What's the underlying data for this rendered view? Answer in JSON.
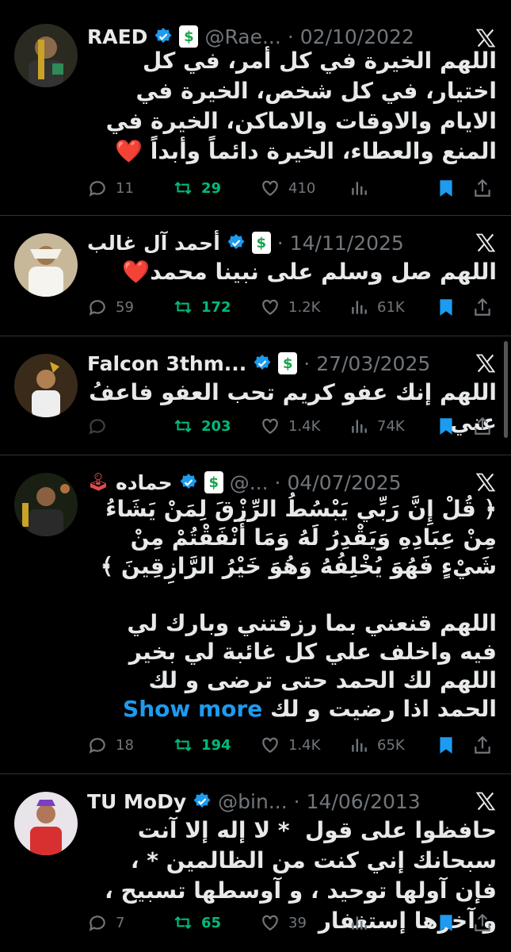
{
  "tweets": [
    {
      "name": "RAED",
      "handle": "@Rae...",
      "dot": "·",
      "date": "02/10/2022",
      "text": "اللهم الخيرة في كل أمر، في كل اختيار، في كل شخص، الخيرة في الايام والاوقات والاماكن، الخيرة في المنع والعطاء، الخيرة دائماً وأبداً ❤️",
      "replies": "11",
      "retweets": "29",
      "likes": "410",
      "views": "",
      "verified": true
    },
    {
      "name": "أحمد آل غالب",
      "handle": "",
      "dot": "·",
      "date": "14/11/2025",
      "text": "اللهم صل وسلم على نبينا محمد❤️",
      "replies": "59",
      "retweets": "172",
      "likes": "1.2K",
      "views": "61K",
      "verified": true
    },
    {
      "name": "Falcon 3thm...",
      "handle": "",
      "dot": "·",
      "date": "27/03/2025",
      "text": "اللهم إنك عفو كريم تحب العفو فاعفُ عني",
      "replies": "",
      "retweets": "203",
      "likes": "1.4K",
      "views": "74K",
      "verified": true
    },
    {
      "name": "حماده",
      "handle": "@...",
      "dot": "·",
      "date": "04/07/2025",
      "text": "﴿ قُلْ إِنَّ رَبِّي يَبْسُطُ الرِّزْقَ لِمَنْ يَشَاءُ مِنْ عِبَادِهِ وَيَقْدِرُ لَهُ وَمَا أَنْفَقْتُمْ مِنْ شَيْءٍ فَهُوَ يُخْلِفُهُ وَهُوَ خَيْرُ الرَّازِقِينَ ﴾\n\nاللهم قنعني بما رزقتني وبارك لي فيه واخلف علي كل غائبة لي بخير اللهم لك الحمد حتى ترضى و لك الحمد اذا رضيت و لك",
      "show_more": "Show more",
      "replies": "18",
      "retweets": "194",
      "likes": "1.4K",
      "views": "65K",
      "verified": true
    },
    {
      "name": "TU MoDy",
      "handle": "@bin...",
      "dot": "·",
      "date": "14/06/2013",
      "text": "حافظوا على قول  * لا إله إلا آنت سبحانك إني كنت من الظالمين * ،  فإن آولها توحيد ، و آوسطها تسبيح ،  و آخرها إستغفار",
      "replies": "7",
      "retweets": "65",
      "likes": "39",
      "views": "",
      "verified": true
    }
  ],
  "colors": {
    "background": "#000000",
    "text": "#e7e9ea",
    "muted": "#71767b",
    "verified": "#1d9bf0",
    "retweet_green": "#00ba7c",
    "bookmark_blue": "#1d9bf0",
    "divider": "#2f3336"
  },
  "icons": [
    "verified-badge-icon",
    "subscription-badge-icon",
    "x-logo-icon",
    "reply-icon",
    "retweet-icon",
    "like-icon",
    "views-icon",
    "bookmark-icon",
    "share-icon",
    "joystick-icon"
  ]
}
